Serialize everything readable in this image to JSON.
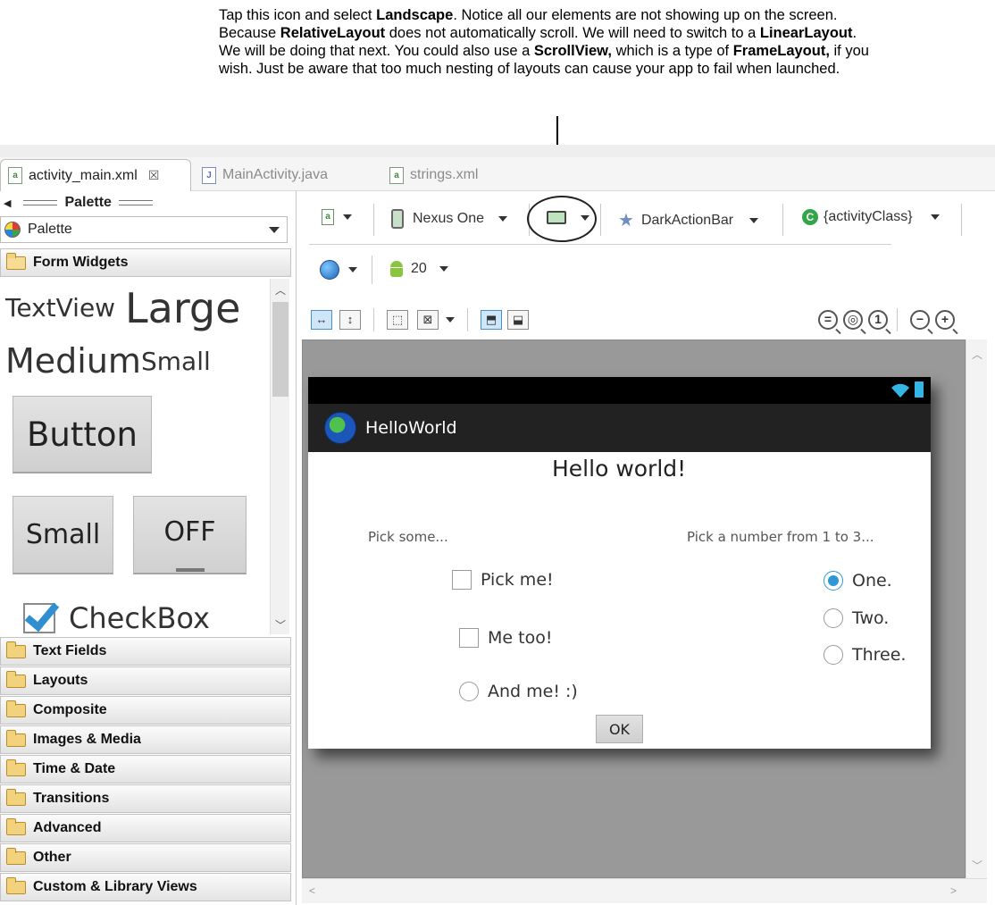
{
  "annotation": {
    "segments": [
      {
        "text": "Tap this icon and select ",
        "bold": false
      },
      {
        "text": "Landscape",
        "bold": true
      },
      {
        "text": ". Notice all our elements are not showing up on the screen. Because ",
        "bold": false
      },
      {
        "text": "RelativeLayout",
        "bold": true
      },
      {
        "text": " does not automatically scroll. We will need to switch to a ",
        "bold": false
      },
      {
        "text": "LinearLayout",
        "bold": true
      },
      {
        "text": ". We will be doing that next. You could also use a ",
        "bold": false
      },
      {
        "text": "ScrollView,",
        "bold": true
      },
      {
        "text": " which is a type of ",
        "bold": false
      },
      {
        "text": "FrameLayout,",
        "bold": true
      },
      {
        "text": " if you wish. Just be aware that too much nesting of layouts can cause your app to fail when launched.",
        "bold": false
      }
    ]
  },
  "editor_tabs": [
    {
      "label": "activity_main.xml",
      "active": true,
      "close": "☒"
    },
    {
      "label": "MainActivity.java",
      "active": false
    },
    {
      "label": "strings.xml",
      "active": false
    }
  ],
  "palette": {
    "title": "Palette",
    "selector_value": "Palette",
    "open_category": "Form Widgets",
    "widgets": {
      "textview": "TextView",
      "large": "Large",
      "medium": "Medium",
      "small": "Small",
      "button": "Button",
      "small_button": "Small",
      "toggle": "OFF",
      "checkbox": "CheckBox"
    },
    "categories": [
      "Text Fields",
      "Layouts",
      "Composite",
      "Images & Media",
      "Time & Date",
      "Transitions",
      "Advanced",
      "Other",
      "Custom & Library Views"
    ]
  },
  "toolbar": {
    "device": "Nexus One",
    "theme": "DarkActionBar",
    "activity": "{activityClass}",
    "api_level": "20"
  },
  "device_screen": {
    "app_title": "HelloWorld",
    "hello": "Hello world!",
    "pick_some": "Pick some...",
    "pick_number": "Pick a number from 1 to 3...",
    "checkboxes": [
      "Pick me!",
      "Me too!"
    ],
    "left_radio": "And me! :)",
    "radios": [
      "One.",
      "Two.",
      "Three."
    ],
    "selected_radio": 0,
    "ok": "OK"
  },
  "colors": {
    "accent": "#2f97d4",
    "canvas_bg": "#999999",
    "action_bar": "#222222"
  }
}
